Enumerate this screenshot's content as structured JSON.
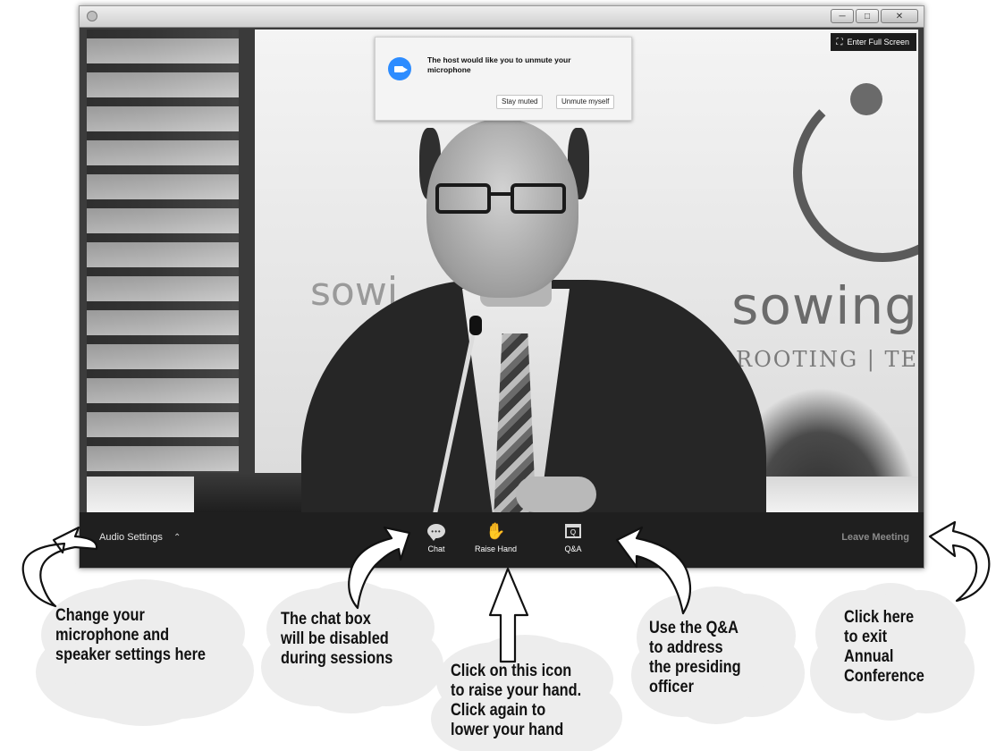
{
  "window": {
    "controls": [
      "minimize",
      "maximize",
      "close"
    ]
  },
  "notification": {
    "icon": "zoom-camera-icon",
    "message": "The host would like you to unmute your microphone",
    "stay_muted_label": "Stay muted",
    "unmute_label": "Unmute myself"
  },
  "fullscreen": {
    "icon": "expand-icon",
    "label": "Enter Full Screen"
  },
  "video_background": {
    "banner_text": "sowing",
    "banner_text_partial": "sowi",
    "banner_subtext": "ROOTING | TE",
    "banner_subtext_partial": "RO"
  },
  "toolbar": {
    "audio_settings_label": "Audio Settings",
    "chat_label": "Chat",
    "chat_icon_glyph": "•••",
    "raise_hand_label": "Raise Hand",
    "qa_label": "Q&A",
    "qa_icon_glyph": "Q",
    "leave_label": "Leave Meeting"
  },
  "annotations": {
    "audio": [
      "Change your",
      "microphone and",
      "speaker settings here"
    ],
    "chat": [
      "The chat box",
      "will be disabled",
      "during sessions"
    ],
    "raise_hand": [
      "Click on this icon",
      "to raise your hand.",
      "Click again to",
      "lower your hand"
    ],
    "qa": [
      "Use the Q&A",
      "to address",
      "the presiding",
      "officer"
    ],
    "leave": [
      "Click here",
      "to exit",
      "Annual",
      "Conference"
    ]
  },
  "colors": {
    "zoom_blue": "#2d8cff",
    "toolbar_bg": "#1f1f1f",
    "cloud_fill": "#ededed"
  }
}
